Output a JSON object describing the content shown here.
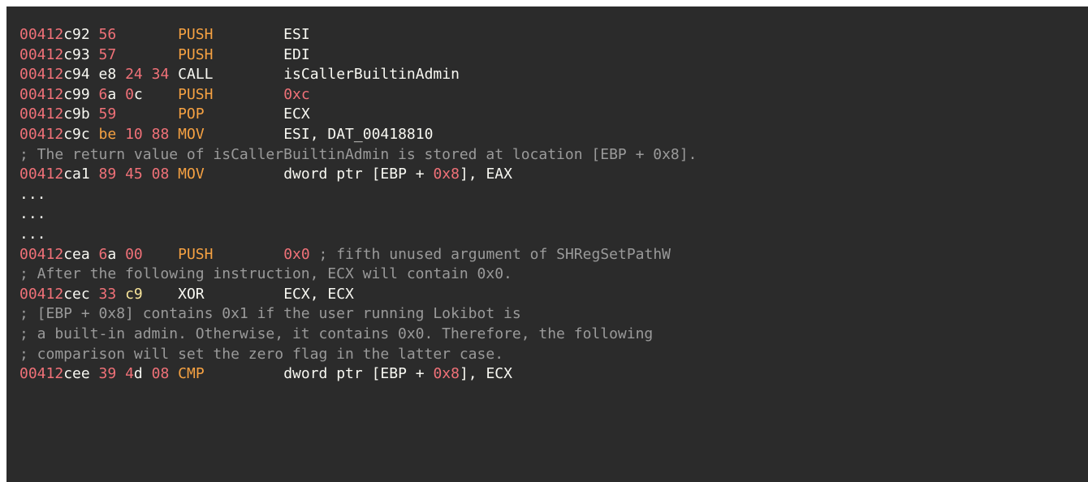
{
  "lines": [
    {
      "type": "instr",
      "addr_hi": "00412",
      "addr_lo": "c92",
      "bytes": [
        {
          "t": "56",
          "c": "red"
        }
      ],
      "mnemonic": "PUSH",
      "mnem_color": "orange",
      "operands": [
        {
          "t": "ESI",
          "c": "op"
        }
      ]
    },
    {
      "type": "instr",
      "addr_hi": "00412",
      "addr_lo": "c93",
      "bytes": [
        {
          "t": "57",
          "c": "red"
        }
      ],
      "mnemonic": "PUSH",
      "mnem_color": "orange",
      "operands": [
        {
          "t": "EDI",
          "c": "op"
        }
      ]
    },
    {
      "type": "instr",
      "addr_hi": "00412",
      "addr_lo": "c94",
      "bytes": [
        {
          "t": "e8",
          "c": "white"
        },
        {
          "t": " ",
          "c": "white"
        },
        {
          "t": "24",
          "c": "red"
        },
        {
          "t": " ",
          "c": "white"
        },
        {
          "t": "34",
          "c": "red"
        }
      ],
      "mnemonic": "CALL",
      "mnem_color": "white",
      "operands": [
        {
          "t": "isCallerBuiltinAdmin",
          "c": "op"
        }
      ]
    },
    {
      "type": "instr",
      "addr_hi": "00412",
      "addr_lo": "c99",
      "bytes": [
        {
          "t": "6",
          "c": "red"
        },
        {
          "t": "a",
          "c": "white"
        },
        {
          "t": " ",
          "c": "white"
        },
        {
          "t": "0",
          "c": "red"
        },
        {
          "t": "c",
          "c": "white"
        }
      ],
      "mnemonic": "PUSH",
      "mnem_color": "orange",
      "operands": [
        {
          "t": "0xc",
          "c": "num"
        }
      ]
    },
    {
      "type": "instr",
      "addr_hi": "00412",
      "addr_lo": "c9b",
      "bytes": [
        {
          "t": "59",
          "c": "red"
        }
      ],
      "mnemonic": "POP",
      "mnem_color": "orange",
      "operands": [
        {
          "t": "ECX",
          "c": "op"
        }
      ]
    },
    {
      "type": "instr",
      "addr_hi": "00412",
      "addr_lo": "c9c",
      "bytes": [
        {
          "t": "be",
          "c": "orange"
        },
        {
          "t": " ",
          "c": "white"
        },
        {
          "t": "10",
          "c": "red"
        },
        {
          "t": " ",
          "c": "white"
        },
        {
          "t": "88",
          "c": "red"
        }
      ],
      "mnemonic": "MOV",
      "mnem_color": "orange",
      "operands": [
        {
          "t": "ESI, DAT_00418810",
          "c": "op"
        }
      ]
    },
    {
      "type": "comment",
      "text": "; The return value of isCallerBuiltinAdmin is stored at location [EBP + 0x8]."
    },
    {
      "type": "instr",
      "addr_hi": "00412",
      "addr_lo": "ca1",
      "bytes": [
        {
          "t": "89",
          "c": "red"
        },
        {
          "t": " ",
          "c": "white"
        },
        {
          "t": "45",
          "c": "red"
        },
        {
          "t": " ",
          "c": "white"
        },
        {
          "t": "08",
          "c": "red"
        }
      ],
      "mnemonic": "MOV",
      "mnem_color": "orange",
      "operands": [
        {
          "t": "dword ptr [EBP + ",
          "c": "op"
        },
        {
          "t": "0x8",
          "c": "num"
        },
        {
          "t": "], EAX",
          "c": "op"
        }
      ]
    },
    {
      "type": "ellipsis",
      "text": "..."
    },
    {
      "type": "ellipsis",
      "text": "..."
    },
    {
      "type": "ellipsis",
      "text": "..."
    },
    {
      "type": "instr",
      "addr_hi": "00412",
      "addr_lo": "cea",
      "bytes": [
        {
          "t": "6",
          "c": "red"
        },
        {
          "t": "a",
          "c": "white"
        },
        {
          "t": " ",
          "c": "white"
        },
        {
          "t": "00",
          "c": "red"
        }
      ],
      "mnemonic": "PUSH",
      "mnem_color": "orange",
      "operands": [
        {
          "t": "0x0",
          "c": "num"
        },
        {
          "t": " ; fifth unused argument of SHRegSetPathW",
          "c": "comment"
        }
      ]
    },
    {
      "type": "comment",
      "text": "; After the following instruction, ECX will contain 0x0."
    },
    {
      "type": "instr",
      "addr_hi": "00412",
      "addr_lo": "cec",
      "bytes": [
        {
          "t": "33",
          "c": "red"
        },
        {
          "t": " ",
          "c": "white"
        },
        {
          "t": "c9",
          "c": "yellow"
        }
      ],
      "mnemonic": "XOR",
      "mnem_color": "white",
      "operands": [
        {
          "t": "ECX, ECX",
          "c": "op"
        }
      ]
    },
    {
      "type": "comment",
      "text": "; [EBP + 0x8] contains 0x1 if the user running Lokibot is"
    },
    {
      "type": "comment",
      "text": "; a built-in admin. Otherwise, it contains 0x0. Therefore, the following"
    },
    {
      "type": "comment",
      "text": "; comparison will set the zero flag in the latter case."
    },
    {
      "type": "instr",
      "addr_hi": "00412",
      "addr_lo": "cee",
      "bytes": [
        {
          "t": "39",
          "c": "red"
        },
        {
          "t": " ",
          "c": "white"
        },
        {
          "t": "4",
          "c": "red"
        },
        {
          "t": "d",
          "c": "white"
        },
        {
          "t": " ",
          "c": "white"
        },
        {
          "t": "08",
          "c": "red"
        }
      ],
      "mnemonic": "CMP",
      "mnem_color": "orange",
      "operands": [
        {
          "t": "dword ptr [EBP + ",
          "c": "op"
        },
        {
          "t": "0x8",
          "c": "num"
        },
        {
          "t": "], ECX",
          "c": "op"
        }
      ]
    }
  ]
}
